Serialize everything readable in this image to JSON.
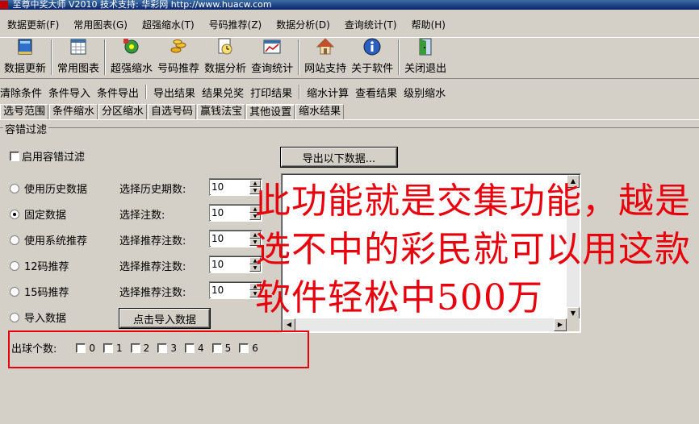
{
  "title_bar": {
    "text": "至尊中奖大师 V2010 技术支持: 华彩网 http://www.huacw.com"
  },
  "menu": [
    "数据更新(F)",
    "常用图表(G)",
    "超强缩水(T)",
    "号码推荐(Z)",
    "数据分析(D)",
    "查询统计(T)",
    "帮助(H)"
  ],
  "toolbar": [
    "数据更新",
    "常用图表",
    "超强缩水",
    "号码推荐",
    "数据分析",
    "查询统计",
    "网站支持",
    "关于软件",
    "关闭退出"
  ],
  "actions": [
    "清除条件",
    "条件导入",
    "条件导出",
    "导出结果",
    "结果兑奖",
    "打印结果",
    "缩水计算",
    "查看结果",
    "级别缩水"
  ],
  "tabs": [
    "选号范围",
    "条件缩水",
    "分区缩水",
    "自选号码",
    "赢钱法宝",
    "其他设置",
    "缩水结果"
  ],
  "active_tab": "其他设置",
  "group_title": "容错过滤",
  "enable_checkbox": "启用容错过滤",
  "export_button": "导出以下数据...",
  "options": [
    {
      "label": "使用历史数据",
      "field_label": "选择历史期数:",
      "value": "10",
      "checked": false
    },
    {
      "label": "固定数据",
      "field_label": "选择注数:",
      "value": "10",
      "checked": true
    },
    {
      "label": "使用系统推荐",
      "field_label": "选择推荐注数:",
      "value": "10",
      "checked": false
    },
    {
      "label": "12码推荐",
      "field_label": "选择推荐注数:",
      "value": "10",
      "checked": false
    },
    {
      "label": "15码推荐",
      "field_label": "选择推荐注数:",
      "value": "10",
      "checked": false
    }
  ],
  "import_option": "导入数据",
  "import_button": "点击导入数据",
  "ball_count_label": "出球个数:",
  "ball_counts": [
    "0",
    "1",
    "2",
    "3",
    "4",
    "5",
    "6"
  ],
  "overlay_text": "此功能就是交集功能，越是选不中的彩民就可以用这款软件轻松中500万",
  "colors": {
    "overlay": "#e8000c",
    "window_bg": "#d4d0c8"
  }
}
